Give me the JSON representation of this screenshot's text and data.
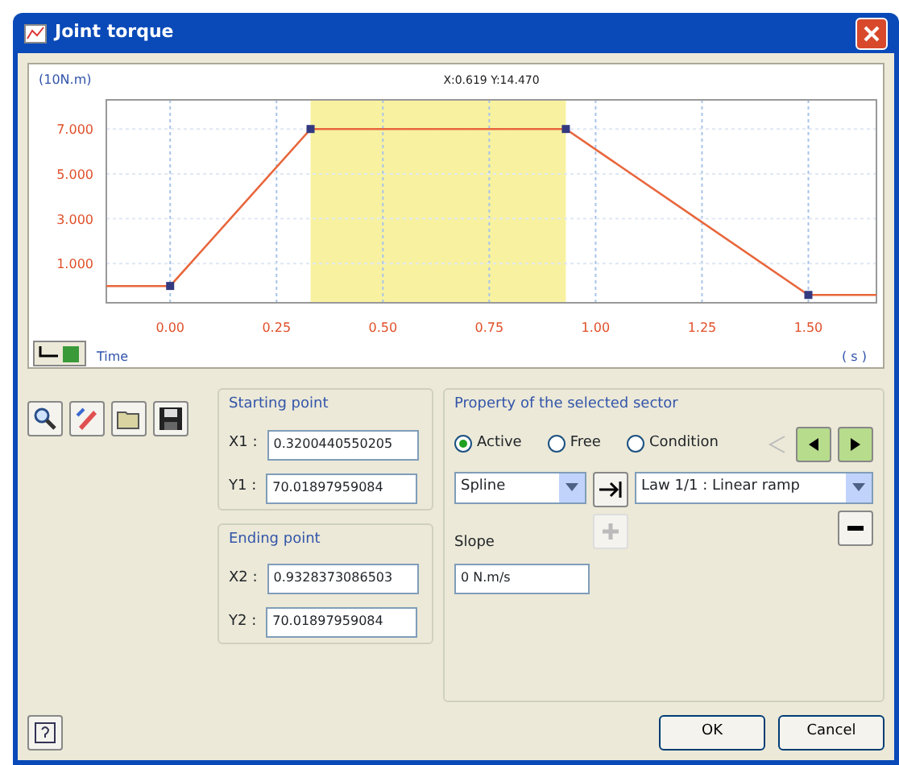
{
  "window": {
    "title": "Joint torque"
  },
  "chart": {
    "readout": "X:0.619 Y:14.470",
    "time_label": "Time",
    "chart_data": {
      "type": "line",
      "xlabel": "( s )",
      "ylabel": "(10N.m)",
      "x": [
        -0.15,
        0,
        0.33,
        0.93,
        1.5,
        1.66
      ],
      "series": [
        {
          "color": "#e8663c",
          "values": [
            0,
            0,
            7,
            7,
            -0.4,
            -0.4
          ]
        }
      ],
      "xlim": [
        -0.15,
        1.66
      ],
      "ylim": [
        -0.75,
        8.3
      ],
      "grid": true,
      "xticks": [
        {
          "value": 0,
          "label": "0.00"
        },
        {
          "value": 0.25,
          "label": "0.25"
        },
        {
          "value": 0.5,
          "label": "0.50"
        },
        {
          "value": 0.75,
          "label": "0.75"
        },
        {
          "value": 1,
          "label": "1.00"
        },
        {
          "value": 1.25,
          "label": "1.25"
        },
        {
          "value": 1.5,
          "label": "1.50"
        }
      ],
      "yticks": [
        {
          "value": 1,
          "label": "1.000"
        },
        {
          "value": 3,
          "label": "3.000"
        },
        {
          "value": 5,
          "label": "5.000"
        },
        {
          "value": 7,
          "label": "7.000"
        }
      ],
      "bands": [
        {
          "axis": "x",
          "from": 0.33,
          "to": 0.93,
          "color": "#f8f2a0"
        }
      ]
    }
  },
  "starting_point": {
    "title": "Starting point",
    "fields": [
      {
        "label": "X1 :",
        "value": "0.3200440550205"
      },
      {
        "label": "Y1 :",
        "value": "70.01897959084"
      }
    ]
  },
  "ending_point": {
    "title": "Ending point",
    "fields": [
      {
        "label": "X2 :",
        "value": "0.9328373086503"
      },
      {
        "label": "Y2 :",
        "value": "70.01897959084"
      }
    ]
  },
  "sector": {
    "title": "Property of the selected sector",
    "modes": [
      {
        "label": "Active",
        "selected": true
      },
      {
        "label": "Free",
        "selected": false
      },
      {
        "label": "Condition",
        "selected": false
      }
    ],
    "type_select": "Spline",
    "law_select": "Law 1/1 : Linear ramp",
    "slope_label": "Slope",
    "slope_value": "0 N.m/s"
  },
  "buttons": [
    {
      "label": "OK"
    },
    {
      "label": "Cancel"
    }
  ]
}
